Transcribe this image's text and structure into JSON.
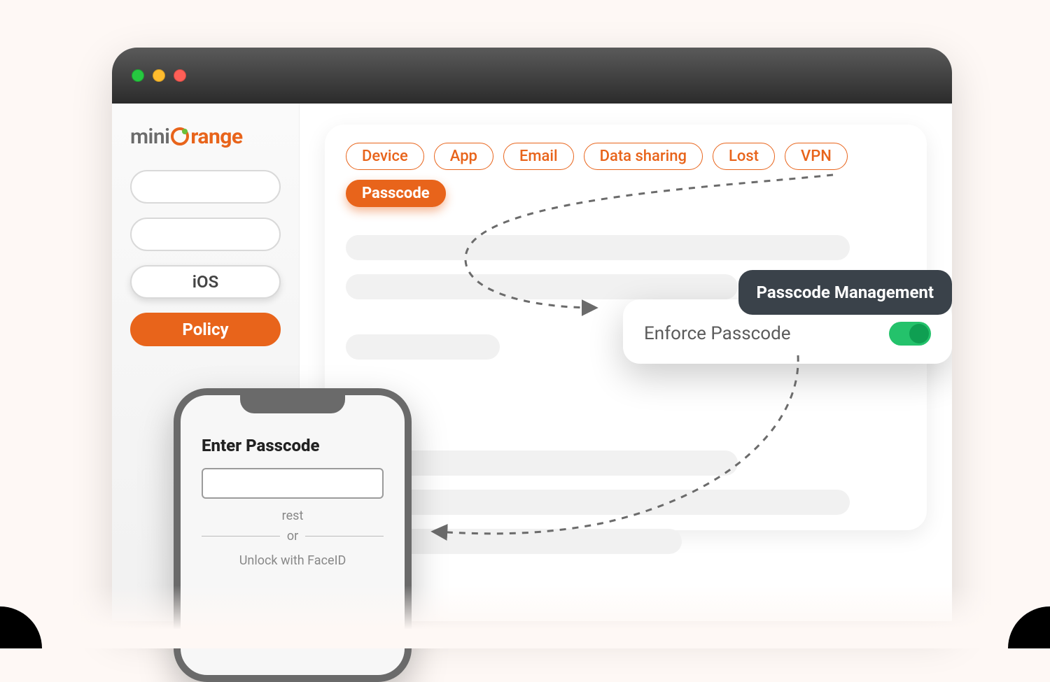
{
  "logo": {
    "prefix": "mini",
    "suffix": "range"
  },
  "sidebar": {
    "items": [
      {
        "label": ""
      },
      {
        "label": ""
      },
      {
        "label": "iOS"
      },
      {
        "label": "Policy"
      }
    ]
  },
  "chips": [
    {
      "label": "Device"
    },
    {
      "label": "App"
    },
    {
      "label": "Email"
    },
    {
      "label": "Data sharing"
    },
    {
      "label": "Lost"
    },
    {
      "label": "VPN"
    },
    {
      "label": "Passcode"
    }
  ],
  "popup": {
    "title": "Passcode Management",
    "row_label": "Enforce Passcode"
  },
  "phone": {
    "title": "Enter Passcode",
    "sub1": "rest",
    "or": "or",
    "sub2": "Unlock with FaceID"
  }
}
